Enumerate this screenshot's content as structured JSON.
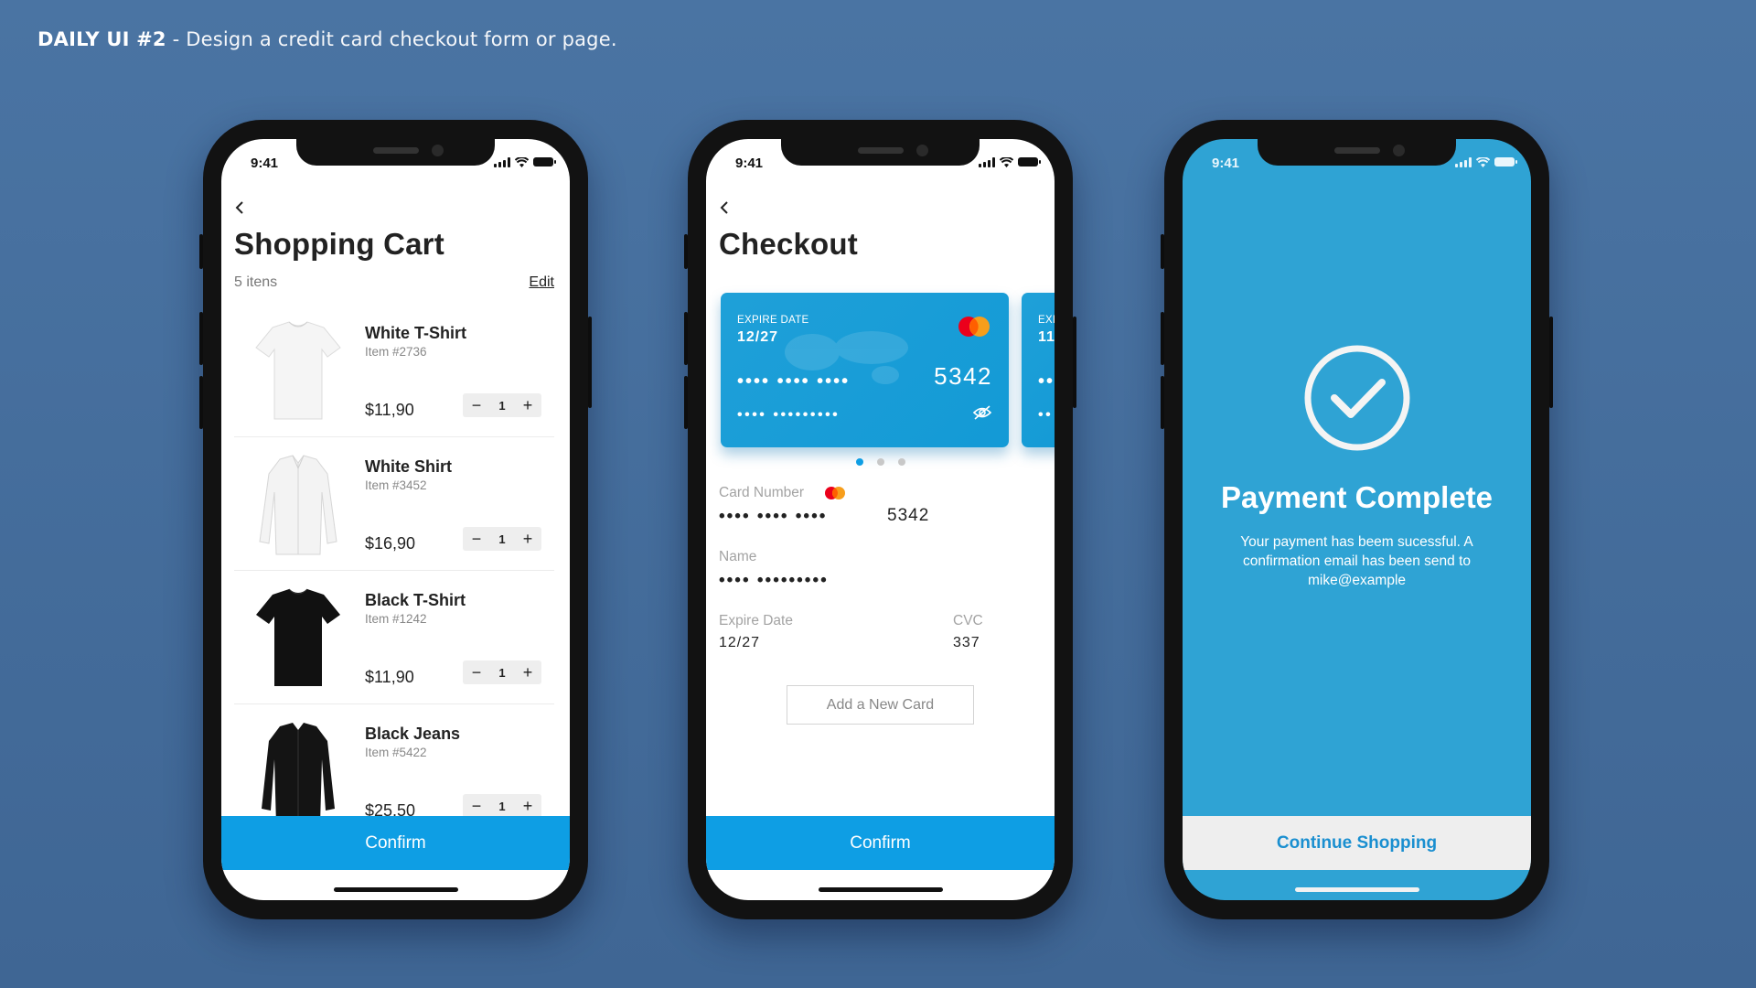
{
  "header": {
    "bold": "DAILY UI #2",
    "rest": "- Design a credit card checkout form or page."
  },
  "status_time": "9:41",
  "cart": {
    "title": "Shopping Cart",
    "count": "5 itens",
    "edit_label": "Edit",
    "items": [
      {
        "name": "White T-Shirt",
        "code": "Item #2736",
        "price": "$11,90",
        "qty": "1",
        "color": "#f5f5f5",
        "type": "tshirt"
      },
      {
        "name": "White Shirt",
        "code": "Item #3452",
        "price": "$16,90",
        "qty": "1",
        "color": "#f1f1f1",
        "type": "shirt"
      },
      {
        "name": "Black T-Shirt",
        "code": "Item #1242",
        "price": "$11,90",
        "qty": "1",
        "color": "#111111",
        "type": "tshirt"
      },
      {
        "name": "Black Jeans",
        "code": "Item #5422",
        "price": "$25,50",
        "qty": "1",
        "color": "#141414",
        "type": "shirt"
      }
    ],
    "minus": "−",
    "plus": "+",
    "confirm_label": "Confirm"
  },
  "checkout": {
    "title": "Checkout",
    "card": {
      "expire_label": "EXPIRE DATE",
      "expire_value": "12/27",
      "number_mask": "•••• •••• ••••",
      "number_last": "5342",
      "name_mask": "•••• •••••••••"
    },
    "card2": {
      "expire_label": "EXP",
      "expire_value": "11"
    },
    "card_number_label": "Card Number",
    "card_number_mask": "•••• •••• ••••",
    "card_number_last": "5342",
    "name_label": "Name",
    "name_mask": "•••• •••••••••",
    "expire_label": "Expire Date",
    "expire_value": "12/27",
    "cvc_label": "CVC",
    "cvc_value": "337",
    "add_card_label": "Add a New Card",
    "confirm_label": "Confirm"
  },
  "complete": {
    "title": "Payment Complete",
    "message": "Your payment has beem sucessful. A confirmation email has been send to mike@example",
    "continue_label": "Continue Shopping"
  },
  "colors": {
    "accent": "#0e9ee4",
    "complete_bg": "#2fa3d4",
    "background": "#4a74a3"
  },
  "icons": [
    "back-chevron-icon",
    "mastercard-icon",
    "eye-off-icon",
    "check-circle-icon",
    "signal-icon",
    "wifi-icon",
    "battery-icon"
  ]
}
